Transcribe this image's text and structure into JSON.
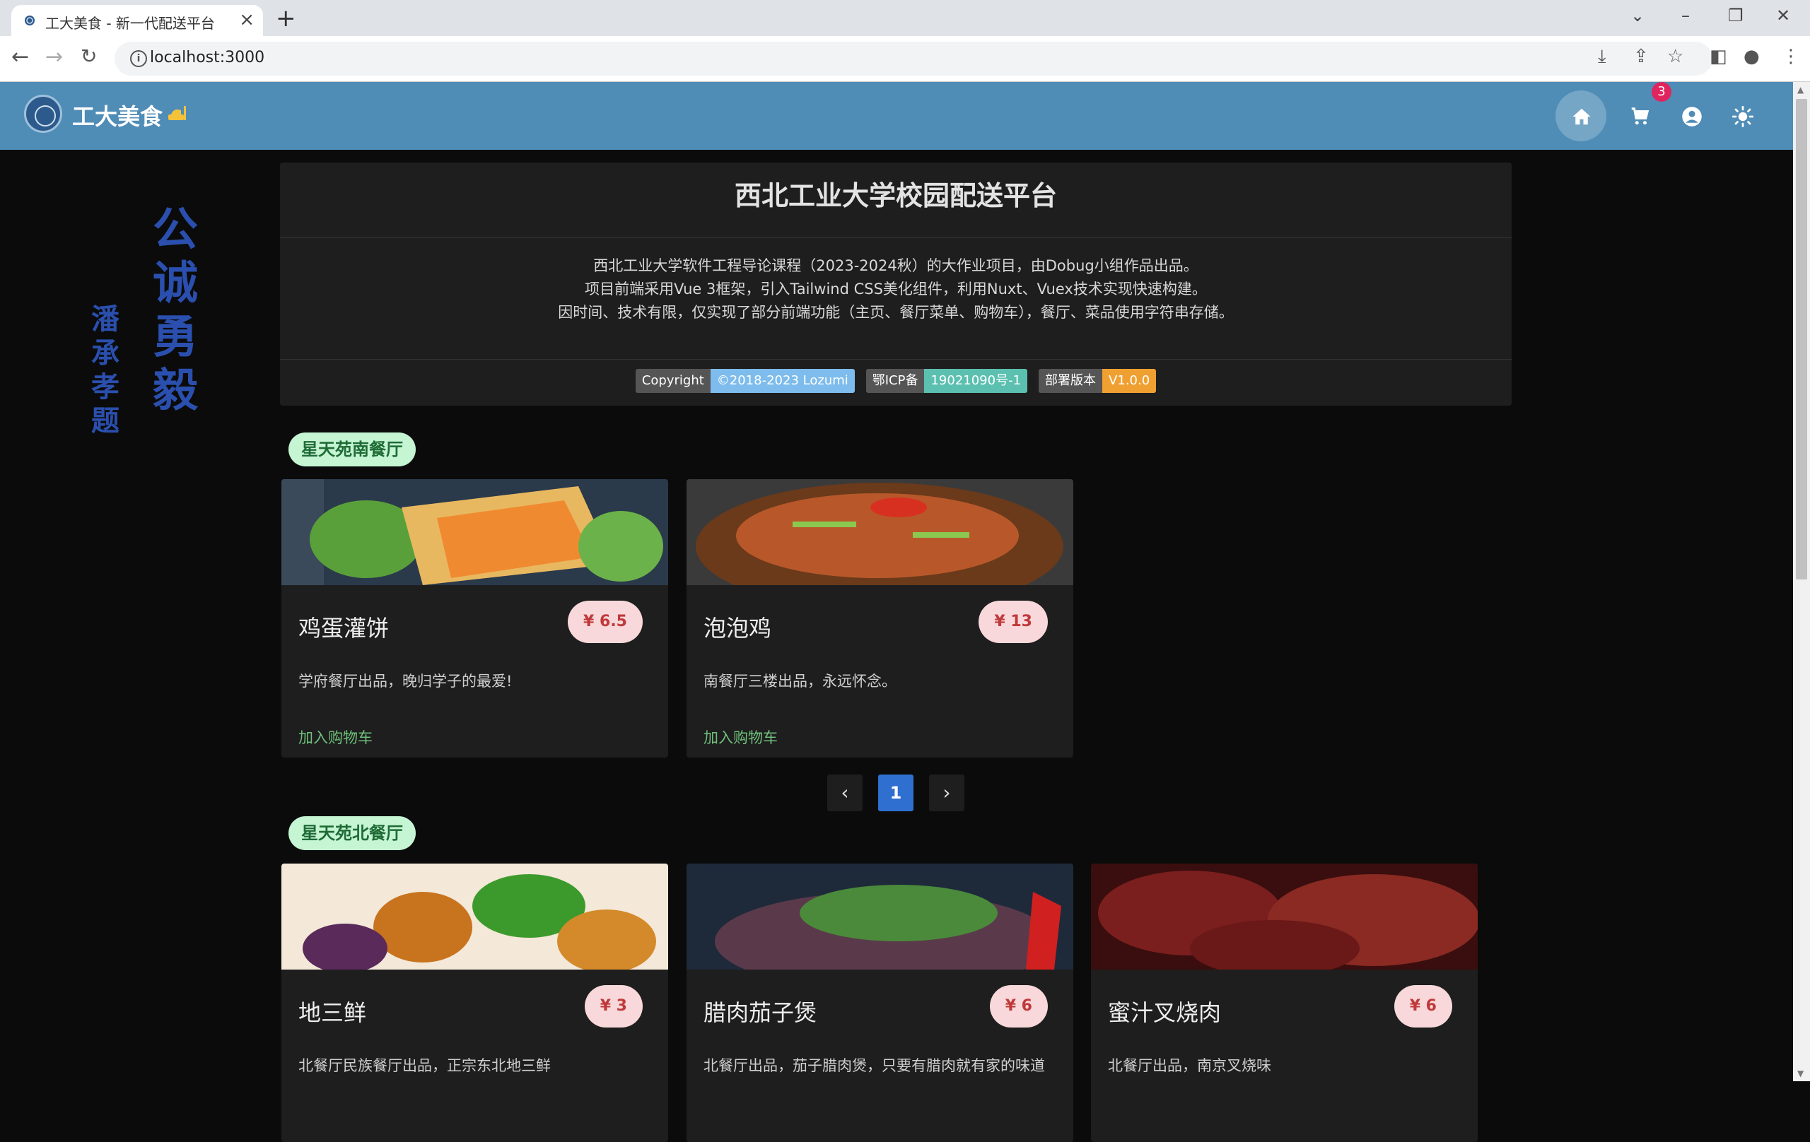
{
  "browser": {
    "tab_title": "工大美食 - 新一代配送平台",
    "url": "localhost:3000"
  },
  "header": {
    "brand": "工大美食",
    "cart_count": "3"
  },
  "calligraphy": {
    "main": "公诚勇毅",
    "signature": "潘承孝题"
  },
  "info": {
    "title": "西北工业大学校园配送平台",
    "lines": [
      "西北工业大学软件工程导论课程（2023-2024秋）的大作业项目，由Dobug小组作品出品。",
      "项目前端采用Vue 3框架，引入Tailwind CSS美化组件，利用Nuxt、Vuex技术实现快速构建。",
      "因时间、技术有限，仅实现了部分前端功能（主页、餐厅菜单、购物车），餐厅、菜品使用字符串存储。"
    ],
    "badges": [
      {
        "left": "Copyright",
        "right": "©2018-2023 Lozumi",
        "color": "#7dbcec"
      },
      {
        "left": "鄂ICP备",
        "right": "19021090号-1",
        "color": "#5bc0b0"
      },
      {
        "left": "部署版本",
        "right": "V1.0.0",
        "color": "#f0a030"
      }
    ]
  },
  "sections": [
    {
      "name": "星天苑南餐厅",
      "dishes": [
        {
          "name": "鸡蛋灌饼",
          "price": "¥ 6.5",
          "desc": "学府餐厅出品，晚归学子的最爱!",
          "action": "加入购物车"
        },
        {
          "name": "泡泡鸡",
          "price": "¥ 13",
          "desc": "南餐厅三楼出品，永远怀念。",
          "action": "加入购物车"
        }
      ],
      "pager": {
        "prev": "‹",
        "current": "1",
        "next": "›"
      }
    },
    {
      "name": "星天苑北餐厅",
      "dishes": [
        {
          "name": "地三鲜",
          "price": "¥ 3",
          "desc": "北餐厅民族餐厅出品，正宗东北地三鲜"
        },
        {
          "name": "腊肉茄子煲",
          "price": "¥ 6",
          "desc": "北餐厅出品，茄子腊肉煲，只要有腊肉就有家的味道"
        },
        {
          "name": "蜜汁叉烧肉",
          "price": "¥ 6",
          "desc": "北餐厅出品，南京叉烧味"
        }
      ]
    }
  ],
  "colors": {
    "header_bg": "#4f8db7",
    "page_bg": "#0b0b0b",
    "card_bg": "#1e1e1e",
    "chip_bg": "#c5f5d3",
    "price_bg": "#f8d8da",
    "accent_blue": "#2f6fd0"
  }
}
